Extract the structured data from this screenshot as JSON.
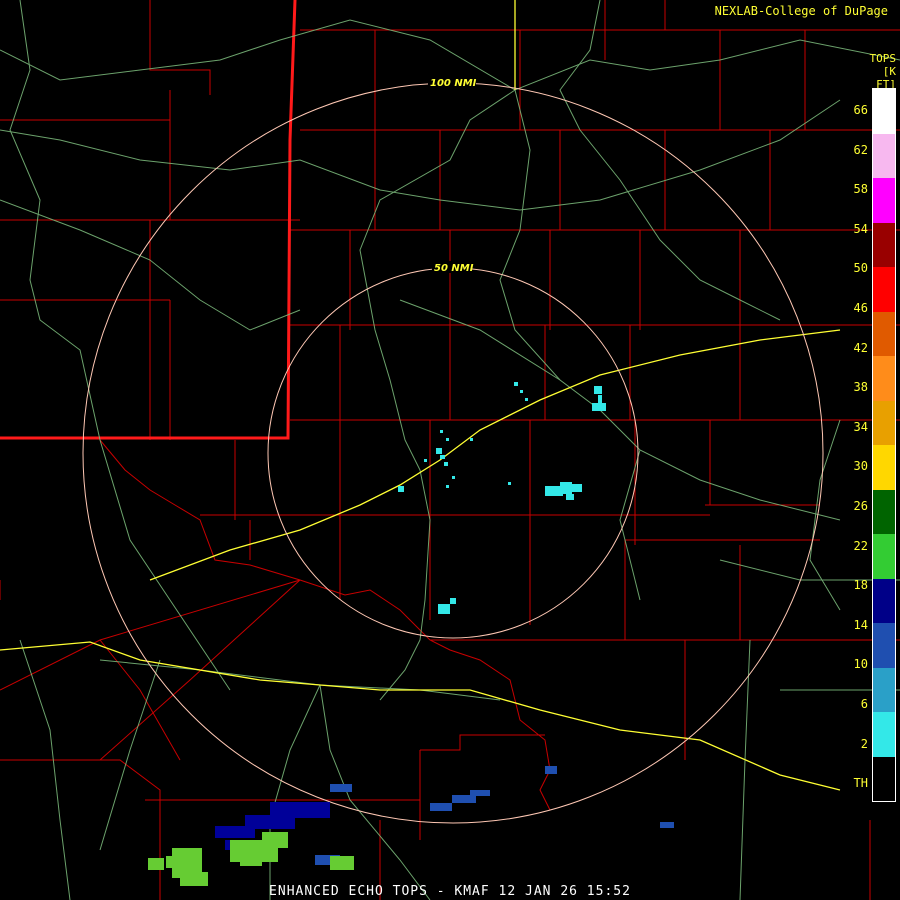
{
  "credit": "NEXLAB-College of DuPage",
  "product_title": "ENHANCED ECHO TOPS - KMAF 12 JAN 26 15:52",
  "legend": {
    "title_line1": "TOPS",
    "title_line2": "[K FT]",
    "ticks": [
      "66",
      "62",
      "58",
      "54",
      "50",
      "46",
      "42",
      "38",
      "34",
      "30",
      "26",
      "22",
      "18",
      "14",
      "10",
      "6",
      "2",
      "TH"
    ],
    "colors": [
      "#ffffff",
      "#f7b8ef",
      "#ff00ff",
      "#990000",
      "#ff0000",
      "#e05a00",
      "#ff8c1a",
      "#e8a000",
      "#ffd700",
      "#006400",
      "#33cc33",
      "#000088",
      "#1f4fb0",
      "#2aa0c8",
      "#33e8e8",
      "#000000"
    ]
  },
  "rings": [
    {
      "label": "100 NMI"
    },
    {
      "label": "50 NMI"
    }
  ],
  "echo_colors": {
    "cyan": "#33e8e8",
    "blue": "#1f4fb0",
    "navy": "#000099",
    "green": "#66cc33"
  }
}
